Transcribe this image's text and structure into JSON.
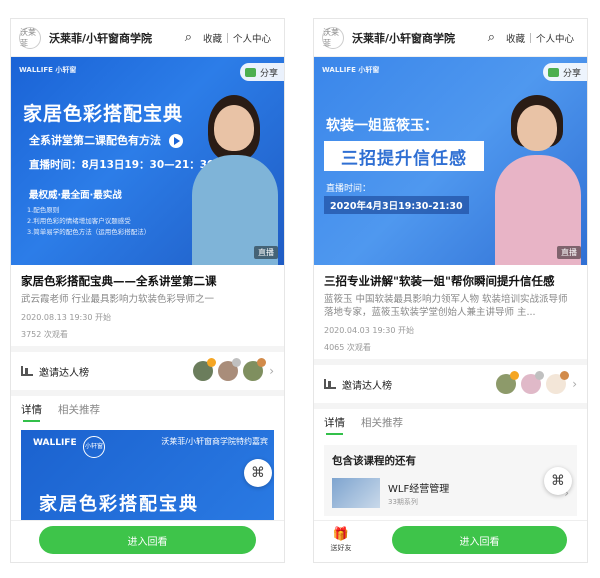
{
  "phones": [
    {
      "header": {
        "logo": "沃莱菲",
        "title": "沃莱菲/小轩窗商学院",
        "favorite": "收藏",
        "personal": "个人中心"
      },
      "banner": {
        "brand": "WALLIFE 小轩窗",
        "share": "分享",
        "title": "家居色彩搭配宝典",
        "subtitle": "全系讲堂第二课配色有方法",
        "time": "直播时间：8月13日19：30—21：30",
        "tags": "最权威·最全面·最实战",
        "lines": [
          "1.配色原则",
          "2.利用色彩的情绪增加客户议题感受",
          "3.简单易学的配色方法（运用色彩搭配法）"
        ],
        "live": "直播"
      },
      "course": {
        "title": "家居色彩搭配宝典——全系讲堂第二课",
        "desc": "武云霞老师 行业最具影响力软装色彩导师之一",
        "date": "2020.08.13 19:30 开始",
        "views": "3752 次观看"
      },
      "invite": {
        "label": "邀请达人榜"
      },
      "tabs": [
        "详情",
        "相关推荐"
      ],
      "detail": {
        "brand": "WALLIFE",
        "brand2": "小轩窗",
        "chain": "沃莱菲/小轩窗商学院特约嘉宾",
        "title": "家居色彩搭配宝典"
      },
      "cta": "进入回看"
    },
    {
      "header": {
        "logo": "沃莱菲",
        "title": "沃莱菲/小轩窗商学院",
        "favorite": "收藏",
        "personal": "个人中心"
      },
      "banner": {
        "brand": "WALLIFE 小轩窗",
        "share": "分享",
        "kicker": "软装一姐蓝筱玉：",
        "main": "三招提升信任感",
        "time_label": "直播时间：",
        "time": "2020年4月3日19:30-21:30",
        "live": "直播"
      },
      "course": {
        "title": "三招专业讲解\"软装一姐\"帮你瞬间提升信任感",
        "desc": "蓝筱玉 中国软装最具影响力领军人物 软装培训实战派导师 落地专家，蓝筱玉软装学堂创始人兼主讲导师 主...",
        "date": "2020.04.03 19:30 开始",
        "views": "4065 次观看"
      },
      "invite": {
        "label": "邀请达人榜"
      },
      "tabs": [
        "详情",
        "相关推荐"
      ],
      "contains": {
        "title": "包含该课程的还有",
        "item_name": "WLF经营管理",
        "item_sub": "33期系列"
      },
      "gift": "送好友",
      "cta": "进入回看"
    }
  ]
}
